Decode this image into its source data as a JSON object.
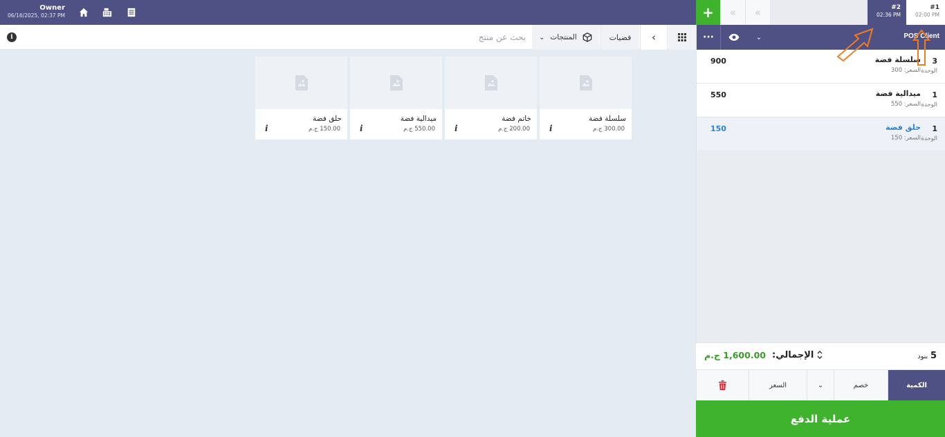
{
  "header": {
    "user_name": "Owner",
    "datetime": "06/16/2025, 02:37 PM",
    "icons": [
      "home-icon",
      "cash-register-icon",
      "receipt-icon"
    ]
  },
  "orders": {
    "add_label": "+",
    "prev_label": "«",
    "next_label": "«",
    "tabs": [
      {
        "number": "#2",
        "time": "02:36 PM"
      },
      {
        "number": "#1",
        "time": "02:00 PM"
      }
    ]
  },
  "toolbar": {
    "info_label": "i",
    "search_placeholder": "بحث عن منتج",
    "category_dropdown_label": "المنتجات",
    "category_dropdown_chevron": "⌄",
    "breadcrumb_label": "فضيات",
    "back_label": "‹"
  },
  "client": {
    "more_label": "···",
    "chevron_label": "⌄",
    "name": "POS Client"
  },
  "products": [
    {
      "name": "سلسلة فضة",
      "price": "300.00 ج.م",
      "info": "i"
    },
    {
      "name": "خاتم فضة",
      "price": "200.00 ج.م",
      "info": "i"
    },
    {
      "name": "ميدالية فضة",
      "price": "550.00 ج.م",
      "info": "i"
    },
    {
      "name": "حلق فضة",
      "price": "150.00 ج.م",
      "info": "i"
    }
  ],
  "order_lines": [
    {
      "qty": "3",
      "unit": "الوحدة",
      "name": "سلسلة فضة",
      "price": "السعر: 300",
      "total": "900"
    },
    {
      "qty": "1",
      "unit": "الوحدة",
      "name": "ميدالية فضة",
      "price": "السعر: 550",
      "total": "550"
    },
    {
      "qty": "1",
      "unit": "الوحدة",
      "name": "حلق فضة",
      "price": "السعر: 150",
      "total": "150"
    }
  ],
  "totals": {
    "items_count": "5",
    "items_word": "بنود",
    "total_label": "الإجمالي:",
    "toggle_label": "⌃⌄",
    "total_value": "1,600.00 ج.م"
  },
  "modes": {
    "quantity": "الكمية",
    "discount": "خصم",
    "chevron": "⌄",
    "price": "السعر"
  },
  "pay": {
    "label": "عملية الدفع"
  },
  "colors": {
    "primary": "#4f5185",
    "green": "#3fb32d",
    "total_green": "#3a9b2a",
    "selected_blue": "#2a82d7",
    "trash_red": "#d3232d",
    "annotation_orange": "#f07c22"
  }
}
